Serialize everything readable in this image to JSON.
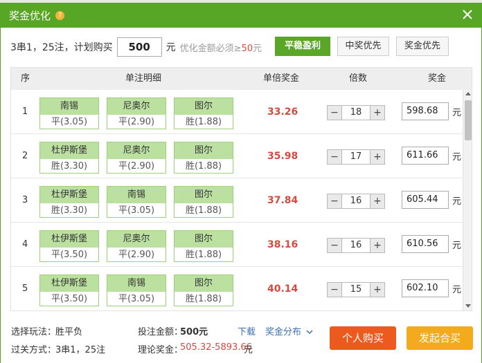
{
  "dialog": {
    "title": "奖金优化",
    "help_icon": "?"
  },
  "plan": {
    "prefix": "3串1，25注，计划购买",
    "amount": "500",
    "unit": "元",
    "note_prefix": "优化金额必须≥",
    "note_value": "50",
    "note_unit": "元"
  },
  "modes": [
    "平稳盈利",
    "中奖优先",
    "奖金优先"
  ],
  "active_mode_color": "#5aa728",
  "table": {
    "headers": [
      "序",
      "单注明细",
      "单倍奖金",
      "倍数",
      "奖金"
    ],
    "rows": [
      {
        "idx": "1",
        "teams": [
          {
            "name": "南锡",
            "odds": "平(3.05)"
          },
          {
            "name": "尼奥尔",
            "odds": "平(2.90)"
          },
          {
            "name": "图尔",
            "odds": "胜(1.88)"
          }
        ],
        "prize": "33.26",
        "multiple": "18",
        "amount": "598.68",
        "unit": "元"
      },
      {
        "idx": "2",
        "teams": [
          {
            "name": "杜伊斯堡",
            "odds": "胜(3.30)"
          },
          {
            "name": "尼奥尔",
            "odds": "平(2.90)"
          },
          {
            "name": "图尔",
            "odds": "胜(1.88)"
          }
        ],
        "prize": "35.98",
        "multiple": "17",
        "amount": "611.66",
        "unit": "元"
      },
      {
        "idx": "3",
        "teams": [
          {
            "name": "杜伊斯堡",
            "odds": "胜(3.30)"
          },
          {
            "name": "南锡",
            "odds": "平(3.05)"
          },
          {
            "name": "图尔",
            "odds": "胜(1.88)"
          }
        ],
        "prize": "37.84",
        "multiple": "16",
        "amount": "605.44",
        "unit": "元"
      },
      {
        "idx": "4",
        "teams": [
          {
            "name": "杜伊斯堡",
            "odds": "平(3.50)"
          },
          {
            "name": "尼奥尔",
            "odds": "平(2.90)"
          },
          {
            "name": "图尔",
            "odds": "胜(1.88)"
          }
        ],
        "prize": "38.16",
        "multiple": "16",
        "amount": "610.56",
        "unit": "元"
      },
      {
        "idx": "5",
        "teams": [
          {
            "name": "杜伊斯堡",
            "odds": "平(3.50)"
          },
          {
            "name": "南锡",
            "odds": "平(3.05)"
          },
          {
            "name": "图尔",
            "odds": "胜(1.88)"
          }
        ],
        "prize": "40.14",
        "multiple": "15",
        "amount": "602.10",
        "unit": "元"
      }
    ]
  },
  "footer": {
    "play_label": "选择玩法：",
    "play_value": "胜平负",
    "pass_label": "过关方式：",
    "pass_value": "3串1，25注",
    "bet_label": "投注金额：",
    "bet_value": "500元",
    "theory_label": "理论奖金：",
    "theory_value": "505.32-5893.66",
    "theory_unit": "元",
    "download": "下载",
    "distribution": "奖金分布",
    "btn_personal": "个人购买",
    "btn_group": "发起合买"
  },
  "colors": {
    "header": "#58a626",
    "prize": "#d24b41",
    "btn_personal": "#ec5a1e",
    "btn_group": "#f3aa1c"
  }
}
